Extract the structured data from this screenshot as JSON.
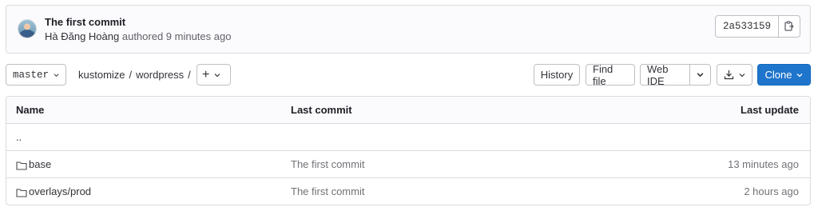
{
  "commit": {
    "title": "The first commit",
    "author": "Hà Đăng Hoàng",
    "meta_suffix": "authored 9 minutes ago",
    "sha": "2a533159"
  },
  "toolbar": {
    "branch": "master",
    "breadcrumb": [
      "kustomize",
      "wordpress"
    ],
    "separator": "/",
    "add_label": "+",
    "history_label": "History",
    "find_file_label": "Find file",
    "web_ide_label": "Web IDE",
    "clone_label": "Clone"
  },
  "table": {
    "headers": {
      "name": "Name",
      "last_commit": "Last commit",
      "last_update": "Last update"
    },
    "parent_dir": "..",
    "rows": [
      {
        "name": "base",
        "last_commit": "The first commit",
        "last_update": "13 minutes ago",
        "icon": "folder-icon"
      },
      {
        "name": "overlays/prod",
        "last_commit": "The first commit",
        "last_update": "2 hours ago",
        "icon": "folder-icon"
      }
    ]
  },
  "colors": {
    "primary": "#1f75cb",
    "border": "#dcdcde",
    "muted": "#737278"
  }
}
